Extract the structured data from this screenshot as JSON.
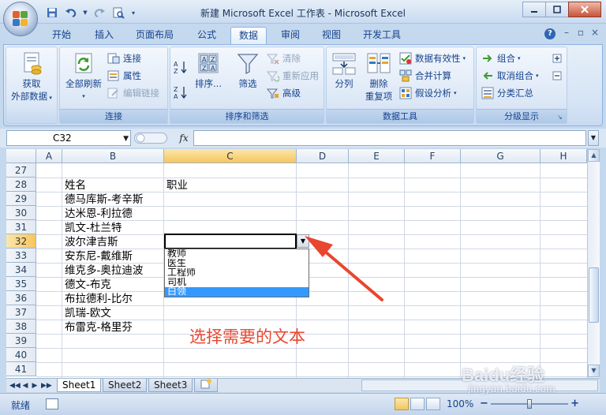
{
  "window": {
    "title": "新建 Microsoft Excel 工作表 - Microsoft Excel",
    "controls": [
      "minimize",
      "maximize",
      "close"
    ]
  },
  "qat": {
    "icons": [
      "save-icon",
      "undo-icon",
      "redo-icon",
      "print-preview-icon",
      "customize-icon"
    ]
  },
  "ribbon_tabs": [
    {
      "label": "开始",
      "active": false
    },
    {
      "label": "插入",
      "active": false
    },
    {
      "label": "页面布局",
      "active": false
    },
    {
      "label": "公式",
      "active": false
    },
    {
      "label": "数据",
      "active": true
    },
    {
      "label": "审阅",
      "active": false
    },
    {
      "label": "视图",
      "active": false
    },
    {
      "label": "开发工具",
      "active": false
    }
  ],
  "ribbon": {
    "get_external": {
      "line1": "获取",
      "line2": "外部数据"
    },
    "connections": {
      "group_label": "连接",
      "refresh_all": "全部刷新",
      "connections": "连接",
      "properties": "属性",
      "edit_links": "编辑链接"
    },
    "sort_filter": {
      "group_label": "排序和筛选",
      "sort": "排序...",
      "filter": "筛选",
      "clear": "清除",
      "reapply": "重新应用",
      "advanced": "高级"
    },
    "data_tools": {
      "group_label": "数据工具",
      "split": "分列",
      "remove_dup_1": "删除",
      "remove_dup_2": "重复项",
      "validation": "数据有效性",
      "consolidate": "合并计算",
      "what_if": "假设分析"
    },
    "outline": {
      "group_label": "分级显示",
      "group": "组合",
      "ungroup": "取消组合",
      "subtotal": "分类汇总"
    }
  },
  "formula_bar": {
    "name_box": "C32",
    "fx_label": "fx",
    "formula": ""
  },
  "grid": {
    "columns": [
      "A",
      "B",
      "C",
      "D",
      "E",
      "F",
      "G",
      "H"
    ],
    "selected_column": "C",
    "rows": [
      "27",
      "28",
      "29",
      "30",
      "31",
      "32",
      "33",
      "34",
      "35",
      "36",
      "37",
      "38",
      "39",
      "40",
      "41"
    ],
    "selected_row": "32",
    "cells": {
      "B28": "姓名",
      "C28": "职业",
      "B29": "德马库斯-考辛斯",
      "B30": "达米恩-利拉德",
      "B31": "凯文-杜兰特",
      "B32": "波尔津吉斯",
      "B33": "安东尼-戴维斯",
      "B34": "维克多-奥拉迪波",
      "B35": "德文-布克",
      "B36": "布拉德利-比尔",
      "B37": "凯瑞-欧文",
      "B38": "布雷克-格里芬"
    }
  },
  "dropdown": {
    "items": [
      "教师",
      "医生",
      "工程师",
      "司机",
      "白领"
    ],
    "highlighted": "白领"
  },
  "annotation": {
    "text": "选择需要的文本",
    "color": "#e8462f"
  },
  "sheets": [
    {
      "label": "Sheet1",
      "active": true
    },
    {
      "label": "Sheet2",
      "active": false
    },
    {
      "label": "Sheet3",
      "active": false
    }
  ],
  "status": {
    "text": "就绪",
    "zoom": "100%"
  },
  "watermark": {
    "brand": "Baidu经验",
    "sub": "jingyan.baidu.com"
  }
}
